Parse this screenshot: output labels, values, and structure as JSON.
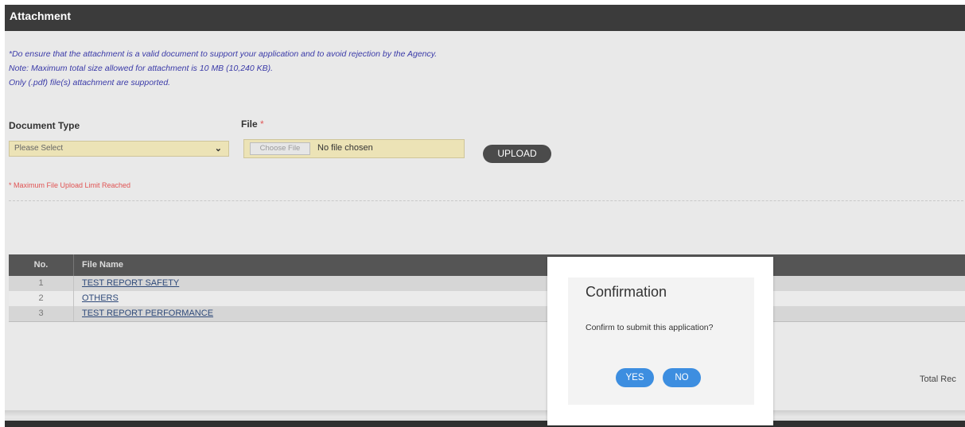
{
  "section": {
    "title": "Attachment",
    "notes": [
      "*Do ensure that the attachment is a valid document to support your application and to avoid rejection by the Agency.",
      "Note: Maximum total size allowed for attachment is 10 MB (10,240 KB).",
      "Only (.pdf) file(s) attachment are supported."
    ]
  },
  "form": {
    "document_type_label": "Document Type",
    "document_type_value": "Please Select",
    "file_label": "File",
    "file_required_mark": "*",
    "choose_file_label": "Choose File",
    "file_status": "No file chosen",
    "upload_label": "UPLOAD",
    "limit_message": "* Maximum File Upload Limit Reached"
  },
  "table": {
    "headers": [
      "No.",
      "File Name"
    ],
    "rows": [
      {
        "no": "1",
        "name": "TEST REPORT SAFETY"
      },
      {
        "no": "2",
        "name": "OTHERS"
      },
      {
        "no": "3",
        "name": "TEST REPORT PERFORMANCE"
      }
    ],
    "total_text": "Total Rec"
  },
  "dialog": {
    "title": "Confirmation",
    "message": "Confirm to submit this application?",
    "yes_label": "YES",
    "no_label": "NO"
  },
  "colors": {
    "header_bg": "#3b3b3b",
    "note_text": "#3a3aa8",
    "field_bg": "#ece3b6",
    "error_text": "#e05353",
    "dialog_button": "#3d8ee0"
  },
  "icons": {
    "select_arrow": "chevron-down-icon"
  }
}
